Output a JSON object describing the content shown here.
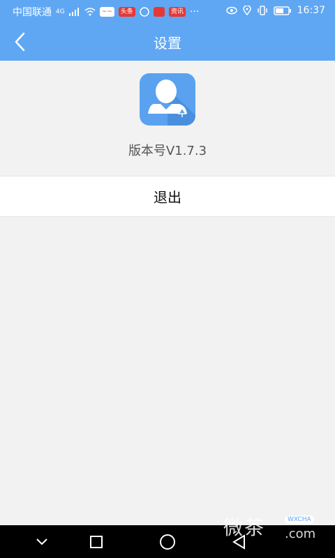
{
  "status_bar": {
    "carrier": "中国联通",
    "network": "4G",
    "badge_toutiao": "头条",
    "badge_news": "资讯",
    "more": "···",
    "time": "16:37"
  },
  "header": {
    "title": "设置"
  },
  "main": {
    "version_text": "版本号V1.7.3",
    "logout_label": "退出"
  },
  "watermark": {
    "text": "微茶",
    "tag": "WXCHA",
    "domain": ".com"
  },
  "colors": {
    "primary": "#5fa7f3",
    "background": "#f2f2f2"
  },
  "icons": {
    "back": "chevron-left-icon",
    "app": "user-avatar-app-icon",
    "nav_back": "triangle-back-icon",
    "nav_home": "circle-home-icon",
    "nav_recent": "square-recent-icon",
    "nav_down": "chevron-down-icon"
  }
}
